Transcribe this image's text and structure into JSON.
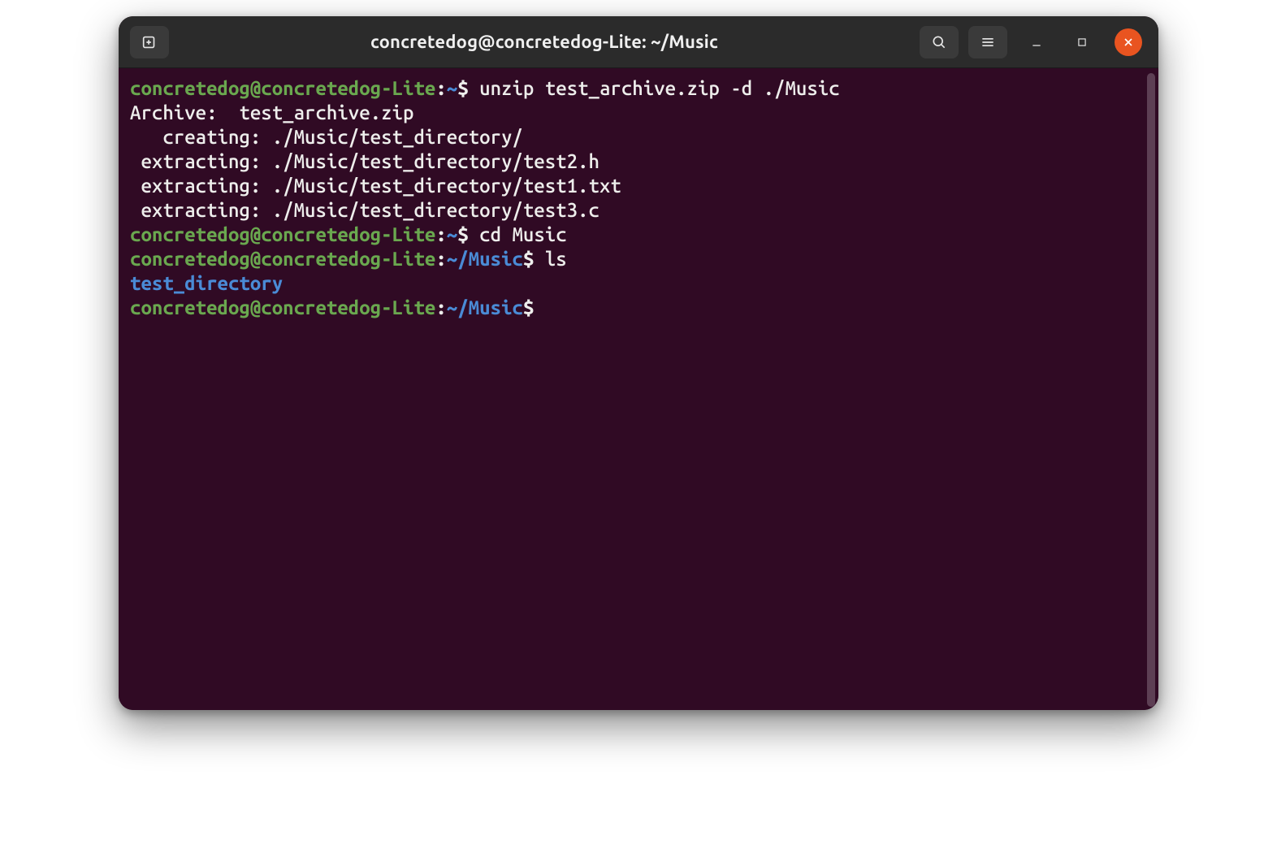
{
  "title": "concretedog@concretedog-Lite: ~/Music",
  "lines": [
    {
      "type": "prompt",
      "userhost": "concretedog@concretedog-Lite",
      "path": "~",
      "cmd": "unzip test_archive.zip -d ./Music"
    },
    {
      "type": "output",
      "text": "Archive:  test_archive.zip"
    },
    {
      "type": "output",
      "text": "   creating: ./Music/test_directory/"
    },
    {
      "type": "output",
      "text": " extracting: ./Music/test_directory/test2.h  "
    },
    {
      "type": "output",
      "text": " extracting: ./Music/test_directory/test1.txt  "
    },
    {
      "type": "output",
      "text": " extracting: ./Music/test_directory/test3.c  "
    },
    {
      "type": "prompt",
      "userhost": "concretedog@concretedog-Lite",
      "path": "~",
      "cmd": "cd Music"
    },
    {
      "type": "prompt",
      "userhost": "concretedog@concretedog-Lite",
      "path": "~/Music",
      "cmd": "ls"
    },
    {
      "type": "dir",
      "text": "test_directory"
    },
    {
      "type": "prompt",
      "userhost": "concretedog@concretedog-Lite",
      "path": "~/Music",
      "cmd": ""
    }
  ],
  "colors": {
    "bg": "#300a24",
    "userhost": "#6aa84f",
    "path": "#4a8bd6",
    "text": "#eeeeec",
    "close": "#e95420"
  }
}
